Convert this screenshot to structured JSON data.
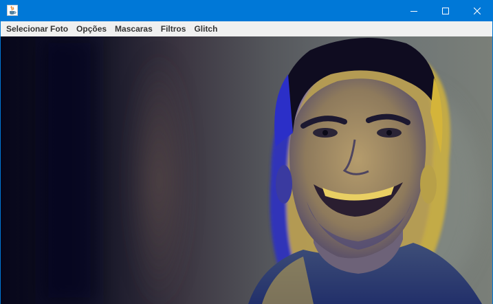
{
  "window": {
    "title": "",
    "app_icon": "java-coffee-icon",
    "controls": [
      "minimize-icon",
      "maximize-icon",
      "close-icon"
    ]
  },
  "menubar": {
    "items": [
      {
        "label": "Selecionar Foto"
      },
      {
        "label": "Opções"
      },
      {
        "label": "Mascaras"
      },
      {
        "label": "Filtros"
      },
      {
        "label": "Glitch"
      }
    ]
  },
  "image": {
    "subject": "portrait-photo",
    "effect": "rgb-glitch-shift"
  },
  "colors": {
    "titlebar": "#0078d7",
    "menubar": "#f0f0f0",
    "menu_text": "#333333",
    "glitch_yellow": "#d4b43a",
    "glitch_blue": "#2b2fc8"
  }
}
